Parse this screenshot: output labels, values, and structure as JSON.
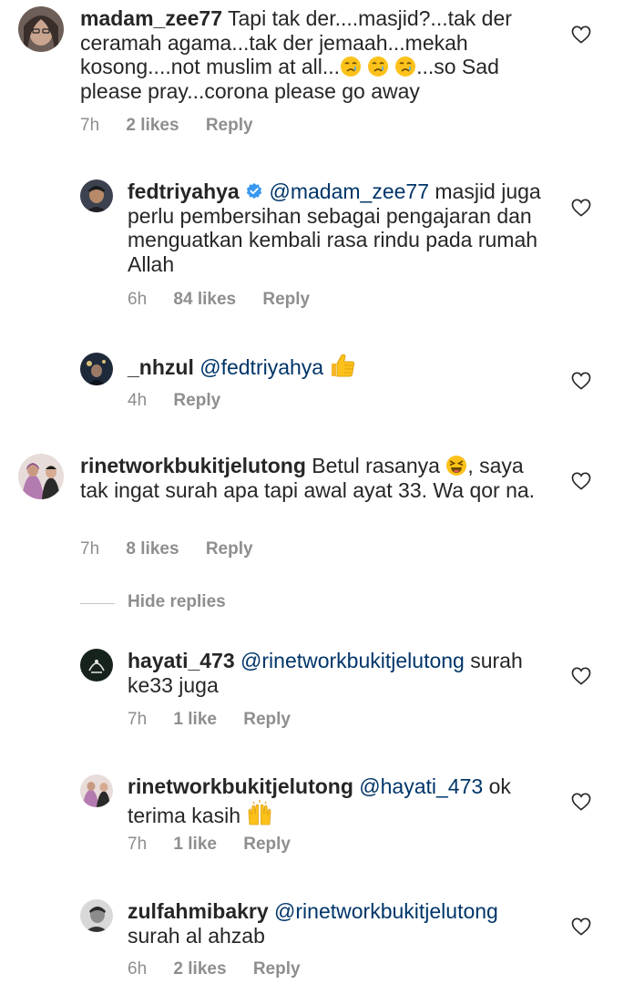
{
  "comments": [
    {
      "username": "madam_zee77",
      "text": "Tapi tak der....masjid?...tak der ceramah agama...tak der jemaah...mekah kosong....not muslim at all...",
      "emoji": "😢😢😢",
      "text_after": "...so Sad please pray...corona please go away",
      "time": "7h",
      "likes": "2 likes",
      "reply": "Reply",
      "avatar_color": "#5a4a45"
    },
    {
      "username": "fedtriyahya",
      "verified": true,
      "mention": "@madam_zee77",
      "text": "masjid juga perlu pembersihan sebagai pengajaran dan menguatkan kembali rasa rindu pada rumah Allah",
      "time": "6h",
      "likes": "84 likes",
      "reply": "Reply",
      "avatar_color": "#2b2b33"
    },
    {
      "username": "_nhzul",
      "mention": "@fedtriyahya",
      "emoji": "👍",
      "time": "4h",
      "reply": "Reply",
      "avatar_color": "#1e2a3a"
    },
    {
      "username": "rinetworkbukitjelutong",
      "text": "Betul rasanya",
      "emoji": "😆",
      "text_after": ", saya tak ingat surah apa tapi awal ayat 33. Wa qor na.",
      "time": "7h",
      "likes": "8 likes",
      "reply": "Reply",
      "avatar_color": "#b58a9a"
    },
    {
      "username": "hayati_473",
      "mention": "@rinetworkbukitjelutong",
      "text": "surah ke33 juga",
      "time": "7h",
      "likes": "1 like",
      "reply": "Reply",
      "avatar_color": "#1d2b24"
    },
    {
      "username": "rinetworkbukitjelutong",
      "mention": "@hayati_473",
      "text": "ok terima kasih",
      "emoji": "🙌",
      "time": "7h",
      "likes": "1 like",
      "reply": "Reply",
      "avatar_color": "#b58a9a"
    },
    {
      "username": "zulfahmibakry",
      "mention": "@rinetworkbukitjelutong",
      "text": "surah al ahzab",
      "time": "6h",
      "likes": "2 likes",
      "reply": "Reply",
      "avatar_color": "#4a4a4a"
    }
  ],
  "hide_replies": "Hide replies",
  "colors": {
    "text": "#262626",
    "secondary": "#8e8e8e",
    "mention": "#003569",
    "verified": "#3897f0"
  },
  "icons": {
    "like": "heart-outline-icon",
    "verified": "verified-badge-icon"
  }
}
